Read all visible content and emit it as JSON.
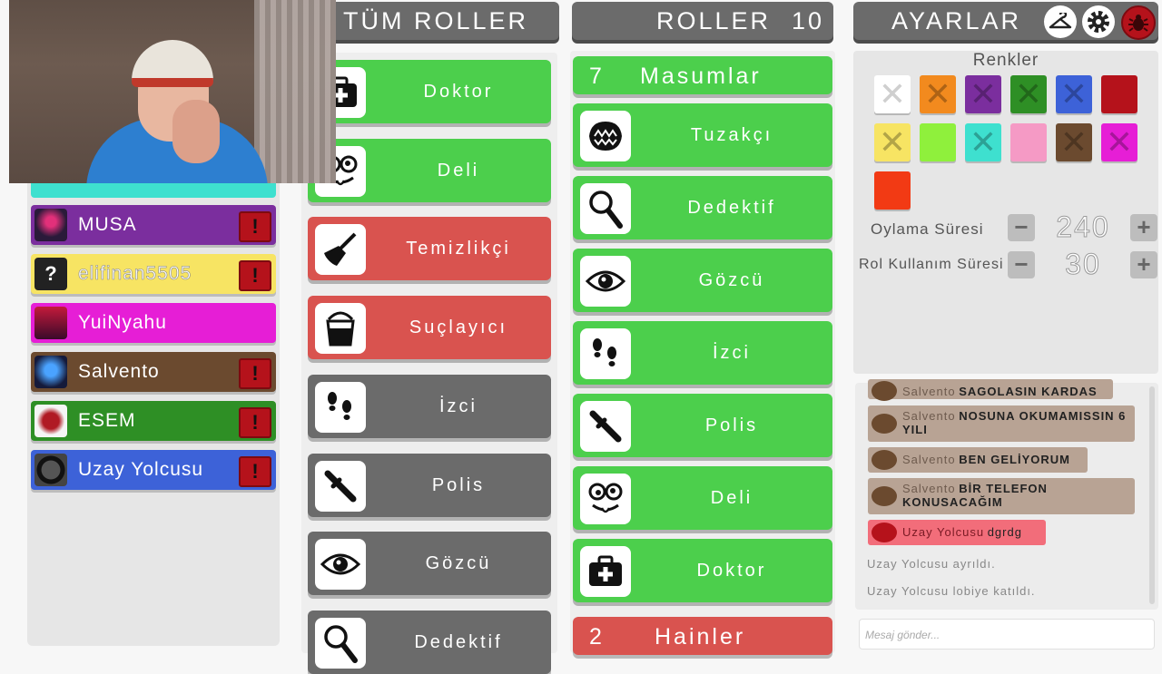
{
  "headers": {
    "all_roles": "TÜM ROLLER",
    "roles": "ROLLER",
    "roles_count": "10",
    "settings": "AYARLAR"
  },
  "players": [
    {
      "name": "MUSA",
      "color": "#7b2e9e",
      "avatar": "hooded-figure"
    },
    {
      "name": "elifinan5505",
      "color": "#f7e463",
      "avatar": "question-mark",
      "avatar_text": "?"
    },
    {
      "name": "YuiNyahu",
      "color": "#e61ed6",
      "avatar": "sunset"
    },
    {
      "name": "Salvento",
      "color": "#6b4a2f",
      "avatar": "neon-face"
    },
    {
      "name": "ESEM",
      "color": "#2e8f25",
      "avatar": "rose"
    },
    {
      "name": "Uzay Yolcusu",
      "color": "#3d62d8",
      "avatar": "circle-logo"
    }
  ],
  "all_roles": [
    {
      "label": "Doktor",
      "team": "green",
      "icon": "medkit-icon"
    },
    {
      "label": "Deli",
      "team": "green",
      "icon": "crazy-face-icon"
    },
    {
      "label": "Temizlikçi",
      "team": "red",
      "icon": "broom-icon"
    },
    {
      "label": "Suçlayıcı",
      "team": "red",
      "icon": "bucket-icon"
    },
    {
      "label": "İzci",
      "team": "gray",
      "icon": "footprints-icon"
    },
    {
      "label": "Polis",
      "team": "gray",
      "icon": "baton-icon"
    },
    {
      "label": "Gözcü",
      "team": "gray",
      "icon": "eye-icon"
    },
    {
      "label": "Dedektif",
      "team": "gray",
      "icon": "magnifier-icon"
    }
  ],
  "teams": {
    "innocent_count": "7",
    "innocent_label": "Masumlar",
    "villain_count": "2",
    "villain_label": "Hainler"
  },
  "innocent_roles": [
    {
      "label": "Tuzakçı",
      "icon": "bear-trap-icon"
    },
    {
      "label": "Dedektif",
      "icon": "magnifier-icon"
    },
    {
      "label": "Gözcü",
      "icon": "eye-icon"
    },
    {
      "label": "İzci",
      "icon": "footprints-icon"
    },
    {
      "label": "Polis",
      "icon": "baton-icon"
    },
    {
      "label": "Deli",
      "icon": "crazy-face-icon"
    },
    {
      "label": "Doktor",
      "icon": "medkit-icon"
    }
  ],
  "settings": {
    "colors_label": "Renkler",
    "swatches": [
      {
        "color": "#ffffff",
        "taken": true
      },
      {
        "color": "#f28a1e",
        "taken": true
      },
      {
        "color": "#7b2e9e",
        "taken": true
      },
      {
        "color": "#2e8f25",
        "taken": true
      },
      {
        "color": "#3d62d8",
        "taken": true
      },
      {
        "color": "#b5121b",
        "taken": false
      },
      {
        "color": "#f7e463",
        "taken": true
      },
      {
        "color": "#8ff03c",
        "taken": false
      },
      {
        "color": "#3ee0cf",
        "taken": true
      },
      {
        "color": "#f59ac5",
        "taken": false
      },
      {
        "color": "#6b4a2f",
        "taken": true
      },
      {
        "color": "#e61ed6",
        "taken": true
      },
      {
        "color": "#f23a14",
        "taken": false
      }
    ],
    "vote_time_label": "Oylama Süresi",
    "vote_time_value": "240",
    "role_time_label": "Rol Kullanım Süresi",
    "role_time_value": "30"
  },
  "chat": [
    {
      "user": "Salvento",
      "text": "SAGOLASIN KARDAS"
    },
    {
      "user": "Salvento",
      "text": "NOSUNA OKUMAMISSIN 6 YILI"
    },
    {
      "user": "Salvento",
      "text": "BEN GELİYORUM"
    },
    {
      "user": "Salvento",
      "text": "BİR TELEFON KONUSACAĞIM"
    },
    {
      "user": "Uzay Yolcusu",
      "text": "dgrdg"
    }
  ],
  "system_messages": [
    "Uzay Yolcusu ayrıldı.",
    "Uzay Yolcusu lobiye katıldı."
  ],
  "chat_placeholder": "Mesaj gönder..."
}
